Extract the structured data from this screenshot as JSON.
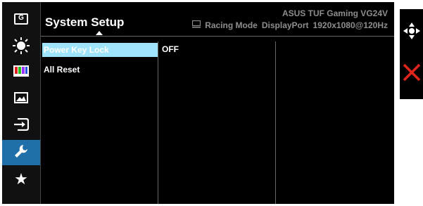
{
  "sidebar": {
    "items": [
      {
        "icon": "gamevisual-icon",
        "label": "G"
      },
      {
        "icon": "bluelight-icon"
      },
      {
        "icon": "color-icon"
      },
      {
        "icon": "image-icon"
      },
      {
        "icon": "input-icon"
      },
      {
        "icon": "wrench-icon",
        "active": true
      },
      {
        "icon": "star-icon"
      }
    ]
  },
  "header": {
    "title": "System Setup",
    "model": "ASUS TUF Gaming VG24V",
    "mode": "Racing Mode",
    "input": "DisplayPort",
    "resolution": "1920x1080@120Hz"
  },
  "menu": {
    "items": [
      {
        "label": "Power Key Lock",
        "selected": true
      },
      {
        "label": "All Reset",
        "selected": false
      }
    ],
    "value": "OFF"
  },
  "controls": {
    "nav": "dpad-icon",
    "close": "close-icon",
    "accent": "#e0251b"
  }
}
